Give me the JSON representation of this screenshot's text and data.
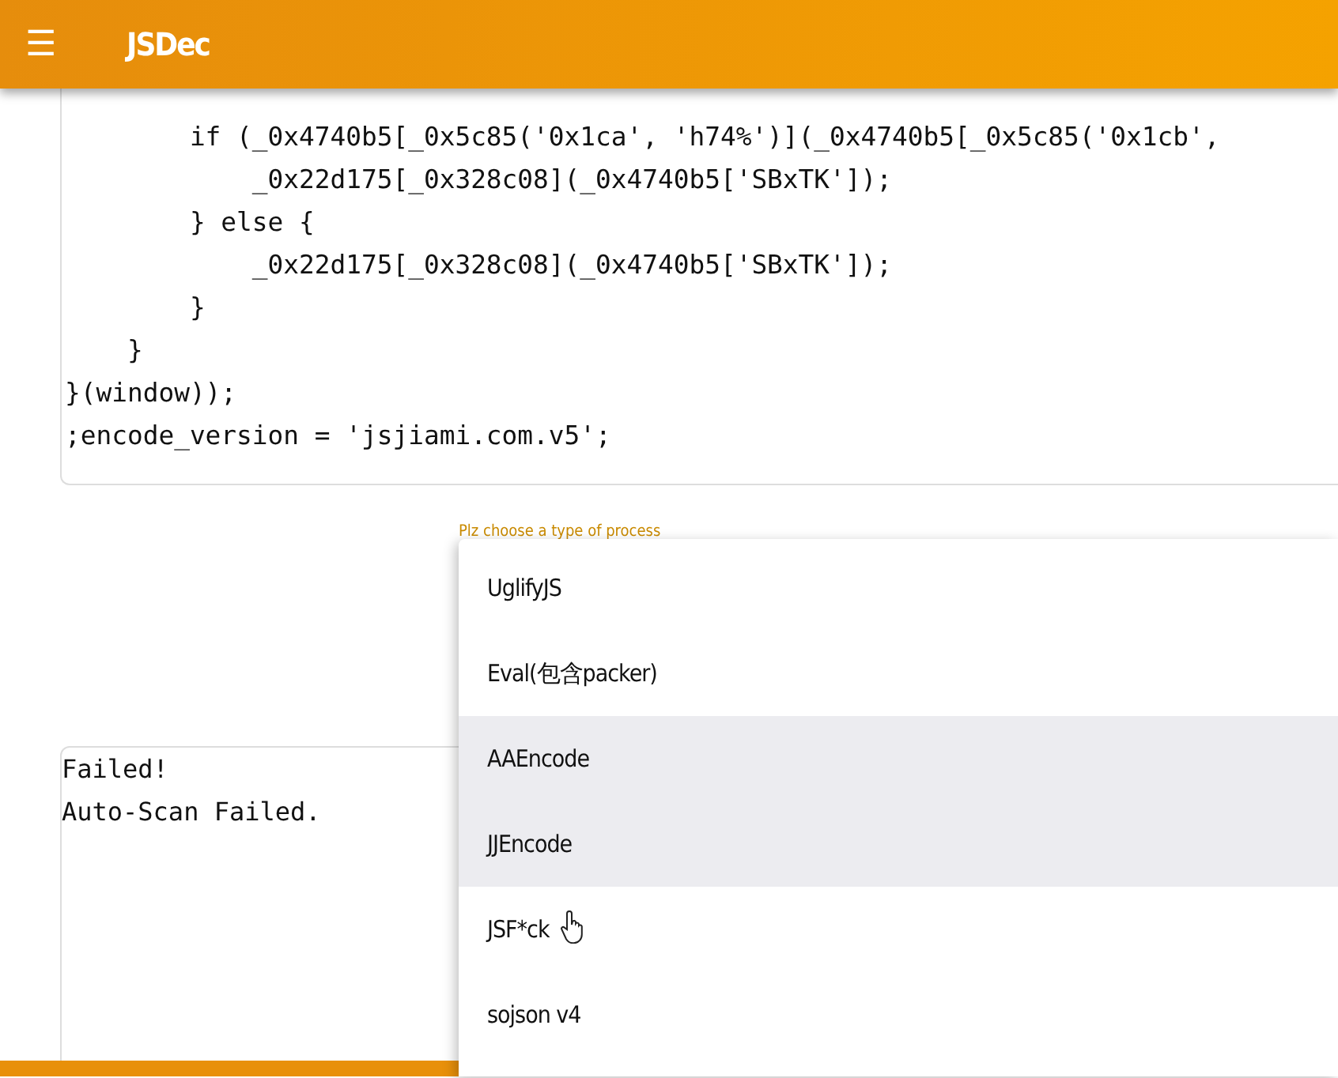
{
  "app_bar": {
    "menu_icon": "☰",
    "title": "JSDec"
  },
  "code_lines": [
    "        if (_0x4740b5[_0x5c85('0x1ca', 'h74%')](_0x4740b5[_0x5c85('0x1cb',",
    "            _0x22d175[_0x328c08](_0x4740b5['SBxTK']);",
    "        } else {",
    "            _0x22d175[_0x328c08](_0x4740b5['SBxTK']);",
    "        }",
    "    }",
    "}(window));",
    ";encode_version = 'jsjiami.com.v5';"
  ],
  "process_select": {
    "label": "Plz choose a type of process",
    "options": [
      {
        "label": "UglifyJS",
        "highlighted": false
      },
      {
        "label": "Eval(包含packer)",
        "highlighted": false
      },
      {
        "label": "AAEncode",
        "highlighted": true
      },
      {
        "label": "JJEncode",
        "highlighted": true
      },
      {
        "label": "JSF*ck",
        "highlighted": false
      },
      {
        "label": "sojson v4",
        "highlighted": false
      }
    ]
  },
  "output_lines": [
    "Failed!",
    "Auto-Scan Failed."
  ]
}
